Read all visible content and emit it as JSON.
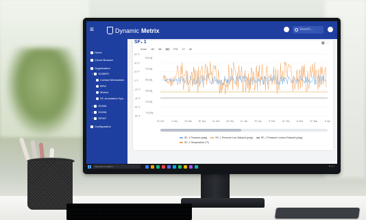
{
  "app": {
    "brand_prefix": "Dynamic",
    "brand_suffix": "Metrix",
    "menu_glyph": "≡"
  },
  "header": {
    "search_placeholder": "Search..."
  },
  "sidebar": {
    "home": "Home",
    "circuit_browser": "Circuit Browser",
    "organization": "Organization",
    "group_1": "SV0BPS",
    "contact_mechanism": "Contact Mechanism",
    "bpm": "BPM",
    "motors": "Motors",
    "sf_annotation": "SF, Annotation Sys...",
    "group_2": "SV006",
    "group_3": "SV008",
    "group_4": "SP007",
    "configuration": "Configuration"
  },
  "panel": {
    "title": "SF₁ 1",
    "range_label": "Zoom",
    "ranges": [
      "1M",
      "3M",
      "6M",
      "YTD",
      "1Y",
      "All"
    ],
    "active_range": "6M"
  },
  "chart_data": {
    "type": "line",
    "y_left_ticks": [
      "90 psig",
      "70 psig",
      "50 psig",
      "30 psig",
      "10 psig",
      "-10 psig"
    ],
    "y_right_ticks": [
      "60 °F",
      "40 °F",
      "20 °F",
      "0 °F",
      "-20 °F",
      "-40 °F",
      "-60 °F",
      "-80 °F"
    ],
    "x_ticks": [
      "19. Oct",
      "2. Nov",
      "16. Nov",
      "30. Nov",
      "14. Dec",
      "28. Dec",
      "11. Jan",
      "25. Jan",
      "8. Feb",
      "22. Feb",
      "8. Mar",
      "22. Mar",
      "5. Apr"
    ],
    "series": [
      {
        "name": "SF₁ 1 Pressure (psig)",
        "color": "#7cb0e8"
      },
      {
        "name": "SF₁ 1 Pressure Low Setpoint (psig)",
        "color": "#e0c070"
      },
      {
        "name": "SF₁ 1 Pressure Lockout Setpoint (psig)",
        "color": "#9a9a9a"
      },
      {
        "name": "SF₁ 1 Temperature (°F)",
        "color": "#f3a35a"
      }
    ]
  },
  "taskbar": {
    "search": "Type here to search"
  },
  "colors": {
    "brand": "#1e3fa0",
    "pressure": "#7cb0e8",
    "temperature": "#f3a35a"
  }
}
